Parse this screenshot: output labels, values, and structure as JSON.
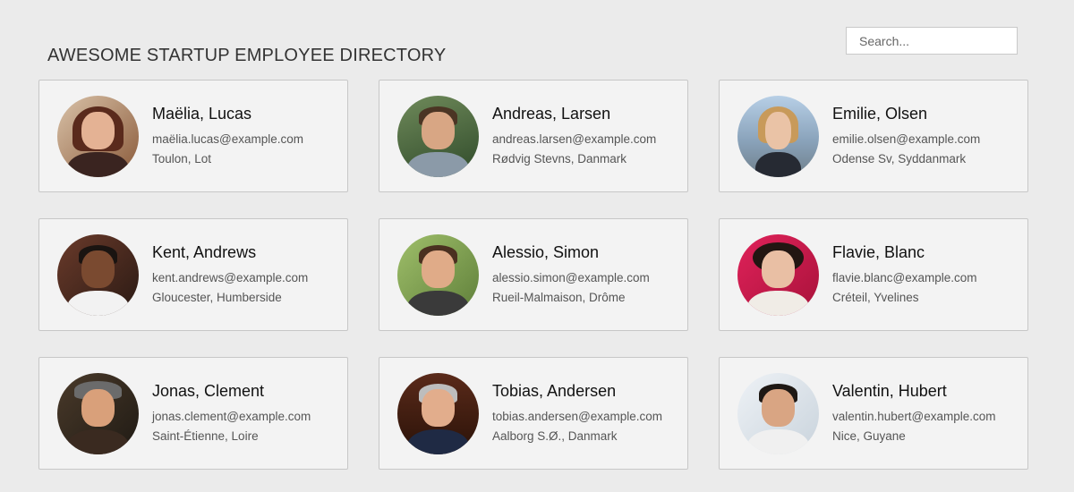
{
  "header": {
    "title": "AWESOME STARTUP EMPLOYEE DIRECTORY",
    "search_placeholder": "Search..."
  },
  "employees": [
    {
      "name": "Maëlia, Lucas",
      "email": "maëlia.lucas@example.com",
      "location": "Toulon, Lot"
    },
    {
      "name": "Andreas, Larsen",
      "email": "andreas.larsen@example.com",
      "location": "Rødvig Stevns, Danmark"
    },
    {
      "name": "Emilie, Olsen",
      "email": "emilie.olsen@example.com",
      "location": "Odense Sv, Syddanmark"
    },
    {
      "name": "Kent, Andrews",
      "email": "kent.andrews@example.com",
      "location": "Gloucester, Humberside"
    },
    {
      "name": "Alessio, Simon",
      "email": "alessio.simon@example.com",
      "location": "Rueil-Malmaison, Drôme"
    },
    {
      "name": "Flavie, Blanc",
      "email": "flavie.blanc@example.com",
      "location": "Créteil, Yvelines"
    },
    {
      "name": "Jonas, Clement",
      "email": "jonas.clement@example.com",
      "location": "Saint-Étienne, Loire"
    },
    {
      "name": "Tobias, Andersen",
      "email": "tobias.andersen@example.com",
      "location": "Aalborg S.Ø., Danmark"
    },
    {
      "name": "Valentin, Hubert",
      "email": "valentin.hubert@example.com",
      "location": "Nice, Guyane"
    }
  ],
  "colors": {
    "page_background": "#ebebeb",
    "card_background": "#f3f3f3",
    "card_border": "#c7c7c7"
  }
}
